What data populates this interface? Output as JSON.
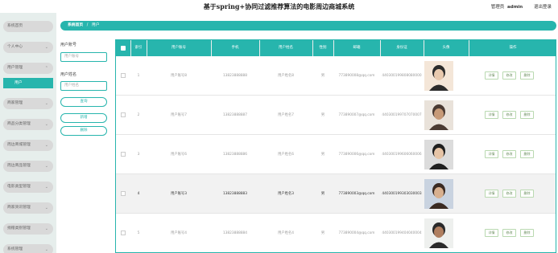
{
  "app": {
    "title": "基于spring+协同过滤推荐算法的电影周边商城系统"
  },
  "user": {
    "role": "管理员",
    "name": "admin",
    "logout": "退出登录"
  },
  "sidebar": {
    "items": [
      {
        "label": "系统首页",
        "chevron": false
      },
      {
        "label": "个人中心",
        "chevron": true
      },
      {
        "label": "用户管理",
        "chevron": true
      },
      {
        "label": "商家管理",
        "chevron": true
      },
      {
        "label": "商品分类管理",
        "chevron": true
      },
      {
        "label": "周边商城管理",
        "chevron": true
      },
      {
        "label": "周边商品管理",
        "chevron": true
      },
      {
        "label": "电影类型管理",
        "chevron": true
      },
      {
        "label": "商家资讯管理",
        "chevron": true
      },
      {
        "label": "捐赠类别管理",
        "chevron": true
      },
      {
        "label": "系统管理",
        "chevron": true
      }
    ],
    "active_sub": "用户"
  },
  "breadcrumb": {
    "home": "系统首页",
    "sep": "/",
    "current": "用户"
  },
  "search": {
    "account_label": "用户账号",
    "account_placeholder": "用户账号",
    "name_label": "用户姓名",
    "name_placeholder": "用户姓名",
    "query_button": "查询",
    "add_button": "新增",
    "delete_button": "删除"
  },
  "table": {
    "headers": [
      "索引",
      "用户账号",
      "手机",
      "用户姓名",
      "性别",
      "邮箱",
      "身份证",
      "头像",
      "操作"
    ],
    "actions": [
      "详情",
      "修改",
      "删除"
    ],
    "rows": [
      {
        "index": "1",
        "account": "用户账号8",
        "phone": "13823888888",
        "name": "用户姓名8",
        "gender": "男",
        "email": "773890008@qq.com",
        "idcard": "440300199808080000"
      },
      {
        "index": "2",
        "account": "用户账号7",
        "phone": "13823888887",
        "name": "用户姓名7",
        "gender": "男",
        "email": "773890007@qq.com",
        "idcard": "440300199707070007"
      },
      {
        "index": "3",
        "account": "用户账号6",
        "phone": "13823888886",
        "name": "用户姓名6",
        "gender": "男",
        "email": "773890006@qq.com",
        "idcard": "440300199606060006"
      },
      {
        "index": "4",
        "account": "用户账号3",
        "phone": "13823888883",
        "name": "用户姓名3",
        "gender": "男",
        "email": "773890003@qq.com",
        "idcard": "440300199303030003"
      },
      {
        "index": "5",
        "account": "用户账号4",
        "phone": "13823888884",
        "name": "用户姓名4",
        "gender": "男",
        "email": "773890004@qq.com",
        "idcard": "440300199404040004"
      }
    ]
  },
  "colors": {
    "accent": "#27b5ad",
    "sidebar_bg": "#e6eeec",
    "nav_pill": "#d9d9d9",
    "action_border": "#b9d9b0"
  }
}
